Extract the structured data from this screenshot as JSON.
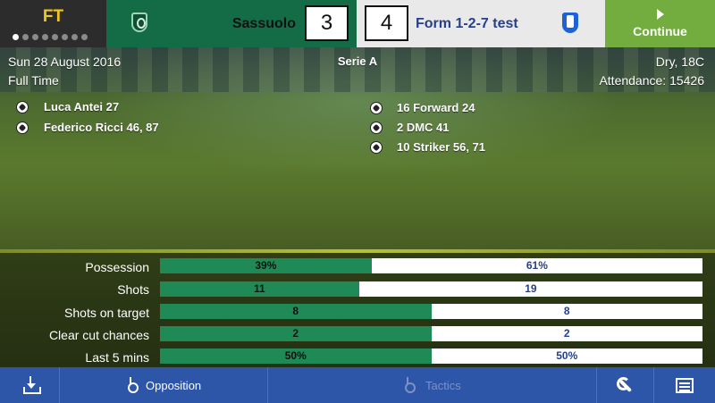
{
  "header": {
    "status_short": "FT",
    "page_dots_total": 8,
    "page_dots_active": 1,
    "home": {
      "name": "Sassuolo",
      "score": "3",
      "badge_icon": "sassuolo-crest-icon"
    },
    "away": {
      "name": "Form 1-2-7 test",
      "score": "4",
      "badge_icon": "blue-shield-crest-icon"
    },
    "continue_label": "Continue"
  },
  "match_info": {
    "date": "Sun 28 August 2016",
    "competition": "Serie A",
    "weather": "Dry, 18C",
    "status": "Full Time",
    "attendance": "Attendance: 15426"
  },
  "goals": {
    "home": [
      {
        "text": "Luca Antei 27"
      },
      {
        "text": "Federico Ricci 46, 87"
      }
    ],
    "away": [
      {
        "text": "16 Forward 24"
      },
      {
        "text": "2 DMC 41"
      },
      {
        "text": "10 Striker 56, 71"
      }
    ]
  },
  "stats": [
    {
      "label": "Possession",
      "home": "39%",
      "away": "61%",
      "home_share": 0.39
    },
    {
      "label": "Shots",
      "home": "11",
      "away": "19",
      "home_share": 0.367
    },
    {
      "label": "Shots on target",
      "home": "8",
      "away": "8",
      "home_share": 0.5
    },
    {
      "label": "Clear cut chances",
      "home": "2",
      "away": "2",
      "home_share": 0.5
    },
    {
      "label": "Last 5 mins",
      "home": "50%",
      "away": "50%",
      "home_share": 0.5
    }
  ],
  "bottom_nav": {
    "opposition_label": "Opposition",
    "tactics_label": "Tactics"
  },
  "colors": {
    "ft_text": "#f3c71c",
    "home_bar": "#1f8a56",
    "away_text": "#27408b",
    "continue_bg": "#73ad3f",
    "nav_bg": "#2d55a8"
  }
}
